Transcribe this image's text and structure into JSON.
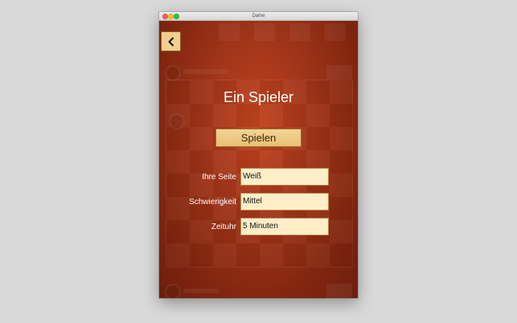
{
  "window": {
    "title": "Dame"
  },
  "nav": {
    "back_icon": "chevron-left-icon"
  },
  "screen": {
    "title": "Ein Spieler",
    "play_label": "Spielen"
  },
  "settings": [
    {
      "label": "Ihre Seite",
      "value": "Weiß"
    },
    {
      "label": "Schwierigkeit",
      "value": "Mittel"
    },
    {
      "label": "Zeituhr",
      "value": "5 Minuten"
    }
  ],
  "colors": {
    "background": "#a3361a",
    "button": "#f1d08e",
    "field": "#fdeec8"
  }
}
